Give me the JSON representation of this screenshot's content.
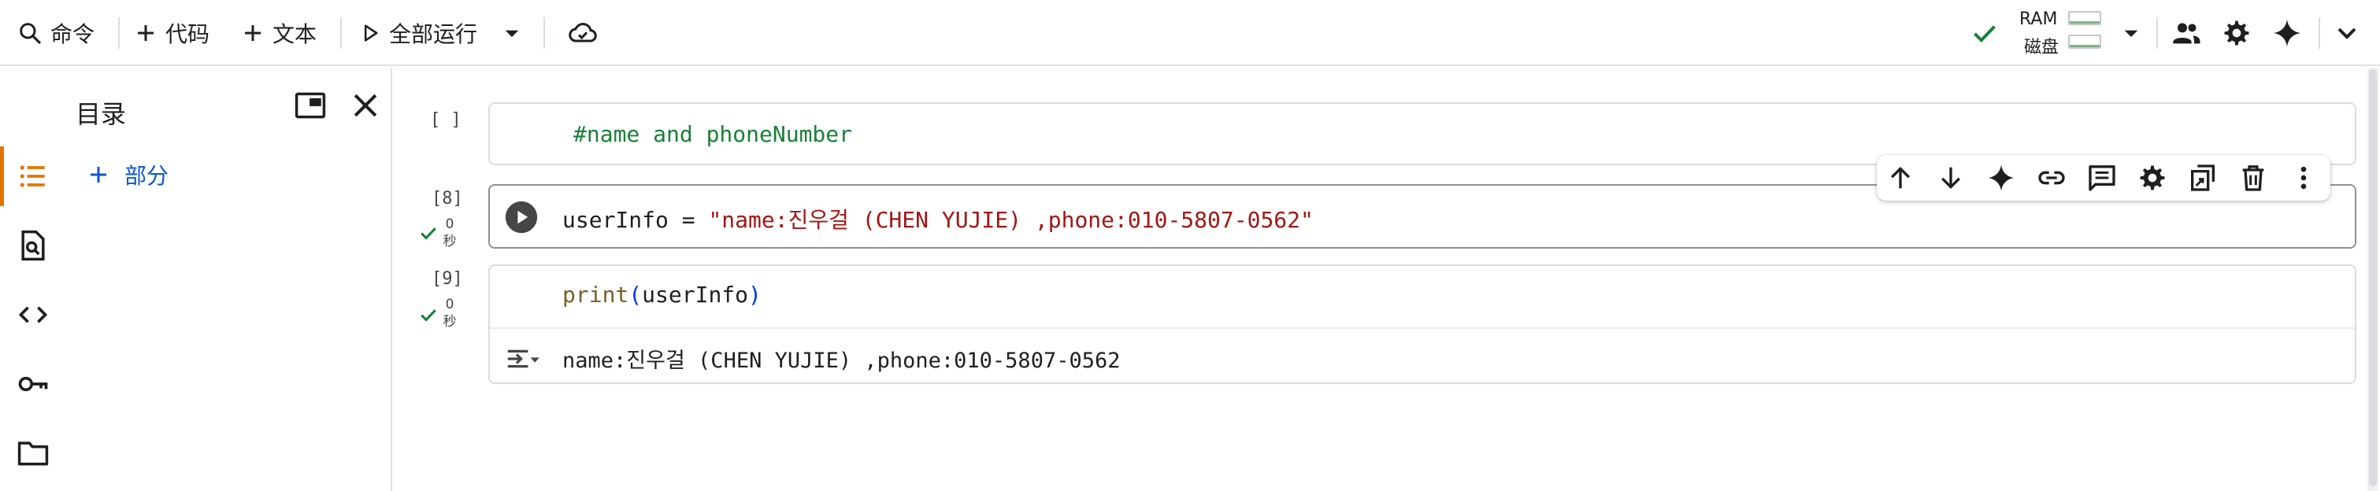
{
  "toolbar": {
    "command_label": "命令",
    "code_label": "代码",
    "text_label": "文本",
    "run_all_label": "全部运行",
    "ram_label": "RAM",
    "disk_label": "磁盘"
  },
  "toc": {
    "title": "目录",
    "add_section_label": "部分"
  },
  "cells": [
    {
      "exec_label": "[ ]",
      "code_tokens": [
        {
          "cls": "c-comment",
          "text": "#name and phoneNumber"
        }
      ]
    },
    {
      "exec_label": "[8]",
      "exec_time_value": "0",
      "exec_time_unit": "秒",
      "code_tokens": [
        {
          "cls": "c-plain",
          "text": "userInfo = "
        },
        {
          "cls": "c-string",
          "text": "\"name:진우걸 (CHEN YUJIE) ,phone:010-5807-0562\""
        }
      ]
    },
    {
      "exec_label": "[9]",
      "exec_time_value": "0",
      "exec_time_unit": "秒",
      "code_tokens": [
        {
          "cls": "c-func",
          "text": "print"
        },
        {
          "cls": "c-paren",
          "text": "("
        },
        {
          "cls": "c-plain",
          "text": "userInfo"
        },
        {
          "cls": "c-paren",
          "text": ")"
        }
      ],
      "output_text": "name:진우걸 (CHEN YUJIE) ,phone:010-5807-0562"
    }
  ],
  "icons": {
    "search": "search-icon",
    "add": "plus-icon",
    "run": "play-icon",
    "cloud": "cloud-check-icon",
    "check": "check-icon",
    "share": "people-icon",
    "settings": "gear-icon",
    "gemini": "sparkle-icon",
    "chevron": "chevron-down-icon"
  },
  "colors": {
    "accent": "#e37400",
    "link": "#0b57d0",
    "check": "#188038",
    "comment": "#188038",
    "string": "#a31515"
  }
}
